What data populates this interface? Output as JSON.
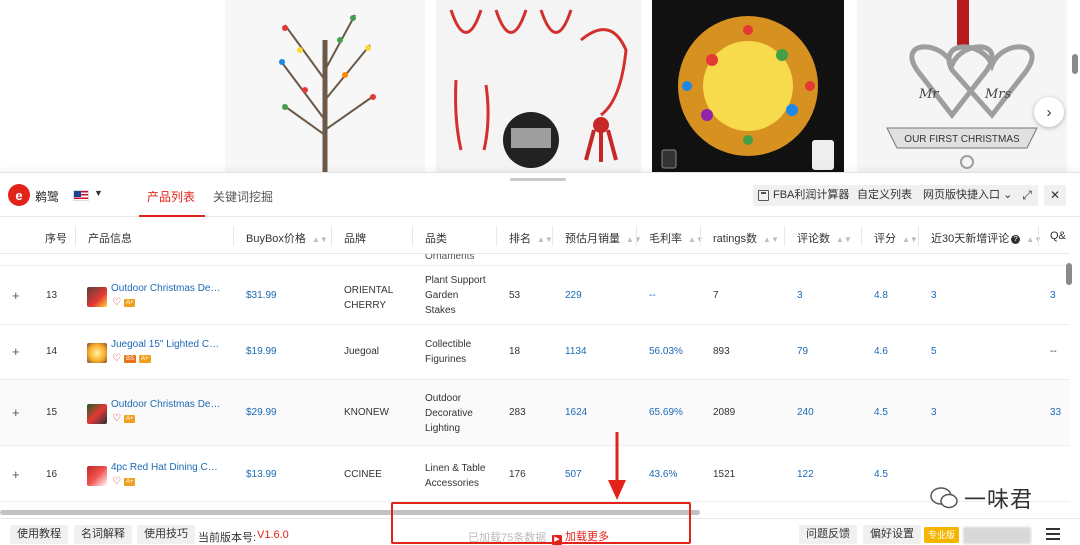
{
  "carousel": {
    "next_symbol": "›",
    "ornament_banner": "OUR FIRST CHRISTMAS",
    "ornament_left_script": "Mr",
    "ornament_right_script": "Mrs"
  },
  "topbar": {
    "logo_glyph": "e",
    "brand": "鹈鹭",
    "country_flag": "US",
    "caret": "▼",
    "tabs": [
      {
        "label": "产品列表",
        "active": true
      },
      {
        "label": "关键词挖掘",
        "active": false
      }
    ],
    "fba_calc": "FBA利润计算器",
    "custom_list": "自定义列表",
    "quick_entry": "网页版快捷入口",
    "expand_symbol": "⤢",
    "close_symbol": "✕"
  },
  "table": {
    "headers": {
      "seq": "序号",
      "info": "产品信息",
      "buybox": "BuyBox价格",
      "brand": "品牌",
      "category": "品类",
      "rank": "排名",
      "monthly_sales": "预估月销量",
      "margin": "毛利率",
      "ratings": "ratings数",
      "reviews": "评论数",
      "score": "评分",
      "new_reviews_30d": "近30天新增评论",
      "qa": "Q&"
    },
    "partial_row_category": "Ornaments",
    "rows": [
      {
        "seq": "13",
        "title": "Outdoor Christmas Dec...",
        "badges": [
          "A+"
        ],
        "price": "$31.99",
        "brand_lines": [
          "ORIENTAL",
          "CHERRY"
        ],
        "category_lines": [
          "Plant Support",
          "Garden",
          "Stakes"
        ],
        "rank": "53",
        "sales": "229",
        "margin": "--",
        "ratings": "7",
        "reviews": "3",
        "score": "4.8",
        "new30": "3",
        "qa": "3"
      },
      {
        "seq": "14",
        "title": "Juegoal 15\" Lighted Chr...",
        "badges": [
          "BS",
          "A+"
        ],
        "price": "$19.99",
        "brand_lines": [
          "Juegoal"
        ],
        "category_lines": [
          "Collectible",
          "Figurines"
        ],
        "rank": "18",
        "sales": "1134",
        "margin": "56.03%",
        "ratings": "893",
        "reviews": "79",
        "score": "4.6",
        "new30": "5",
        "qa": "--"
      },
      {
        "seq": "15",
        "title": "Outdoor Christmas Dec...",
        "badges": [
          "A+"
        ],
        "price": "$29.99",
        "brand_lines": [
          "KNONEW"
        ],
        "category_lines": [
          "Outdoor",
          "Decorative",
          "Lighting"
        ],
        "rank": "283",
        "sales": "1624",
        "margin": "65.69%",
        "ratings": "2089",
        "reviews": "240",
        "score": "4.5",
        "new30": "3",
        "qa": "33"
      },
      {
        "seq": "16",
        "title": "4pc Red Hat Dining Cha...",
        "badges": [
          "A+"
        ],
        "price": "$13.99",
        "brand_lines": [
          "CCINEE"
        ],
        "category_lines": [
          "Linen & Table",
          "Accessories"
        ],
        "rank": "176",
        "sales": "507",
        "margin": "43.6%",
        "ratings": "1521",
        "reviews": "122",
        "score": "4.5",
        "new30": "",
        "qa": ""
      }
    ]
  },
  "footer": {
    "tutorial": "使用教程",
    "glossary": "名词解释",
    "tips": "使用技巧",
    "version_label": "当前版本号:",
    "version": "V1.6.0",
    "loaded_text": "已加载75条数据",
    "load_more": "加载更多",
    "feedback": "问题反馈",
    "preferences": "偏好设置",
    "pro_badge": "专业版"
  },
  "watermark": {
    "text": "一味君"
  },
  "colors": {
    "accent": "#e2231a",
    "link": "#1c6ab6",
    "badge_a_plus": "#f0a020",
    "pro_badge": "#f4b400"
  }
}
